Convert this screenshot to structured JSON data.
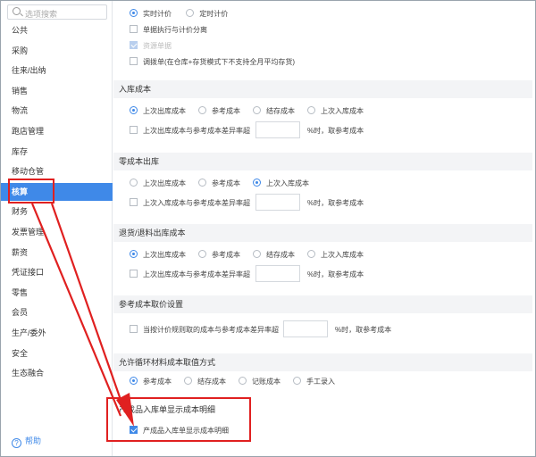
{
  "sidebar": {
    "search_placeholder": "选项搜索",
    "items": [
      "公共",
      "采购",
      "往来/出纳",
      "销售",
      "物流",
      "跑店管理",
      "库存",
      "移动仓管",
      "核算",
      "财务",
      "发票管理",
      "薪资",
      "凭证接口",
      "零售",
      "会员",
      "生产/委外",
      "安全",
      "生态融合"
    ],
    "active": "核算",
    "help": "帮助"
  },
  "content": {
    "pricing": {
      "realtime": "实时计价",
      "scheduled": "定时计价"
    },
    "separate_exec": "单据执行与计价分离",
    "cost_doc": "资源单据",
    "adjust_doc": "调拨单(在仓库+存货模式下不支持全月平均存货)",
    "sections": {
      "inbound": {
        "title": "入库成本",
        "options": [
          "上次出库成本",
          "参考成本",
          "结存成本",
          "上次入库成本"
        ],
        "check": "上次出库成本与参考成本差异率超",
        "suffix": "%时，取参考成本"
      },
      "zero_cost": {
        "title": "零成本出库",
        "options": [
          "上次出库成本",
          "参考成本",
          "上次入库成本"
        ],
        "check": "上次入库成本与参考成本差异率超",
        "suffix": "%时，取参考成本"
      },
      "return": {
        "title": "退货/退料出库成本",
        "options": [
          "上次出库成本",
          "参考成本",
          "结存成本",
          "上次入库成本"
        ],
        "check": "上次出库成本与参考成本差异率超",
        "suffix": "%时，取参考成本"
      },
      "ref_cost": {
        "title": "参考成本取价设置",
        "check": "当按计价规则取的成本与参考成本差异率超",
        "suffix": "%时，取参考成本"
      },
      "cycle": {
        "title": "允许循环材料成本取值方式",
        "options": [
          "参考成本",
          "结存成本",
          "记账成本",
          "手工录入"
        ]
      },
      "product": {
        "title": "产成品入库单显示成本明细",
        "check": "产成品入库单显示成本明细"
      }
    }
  },
  "colors": {
    "accent": "#3f89e8",
    "annotation": "#e02020"
  }
}
